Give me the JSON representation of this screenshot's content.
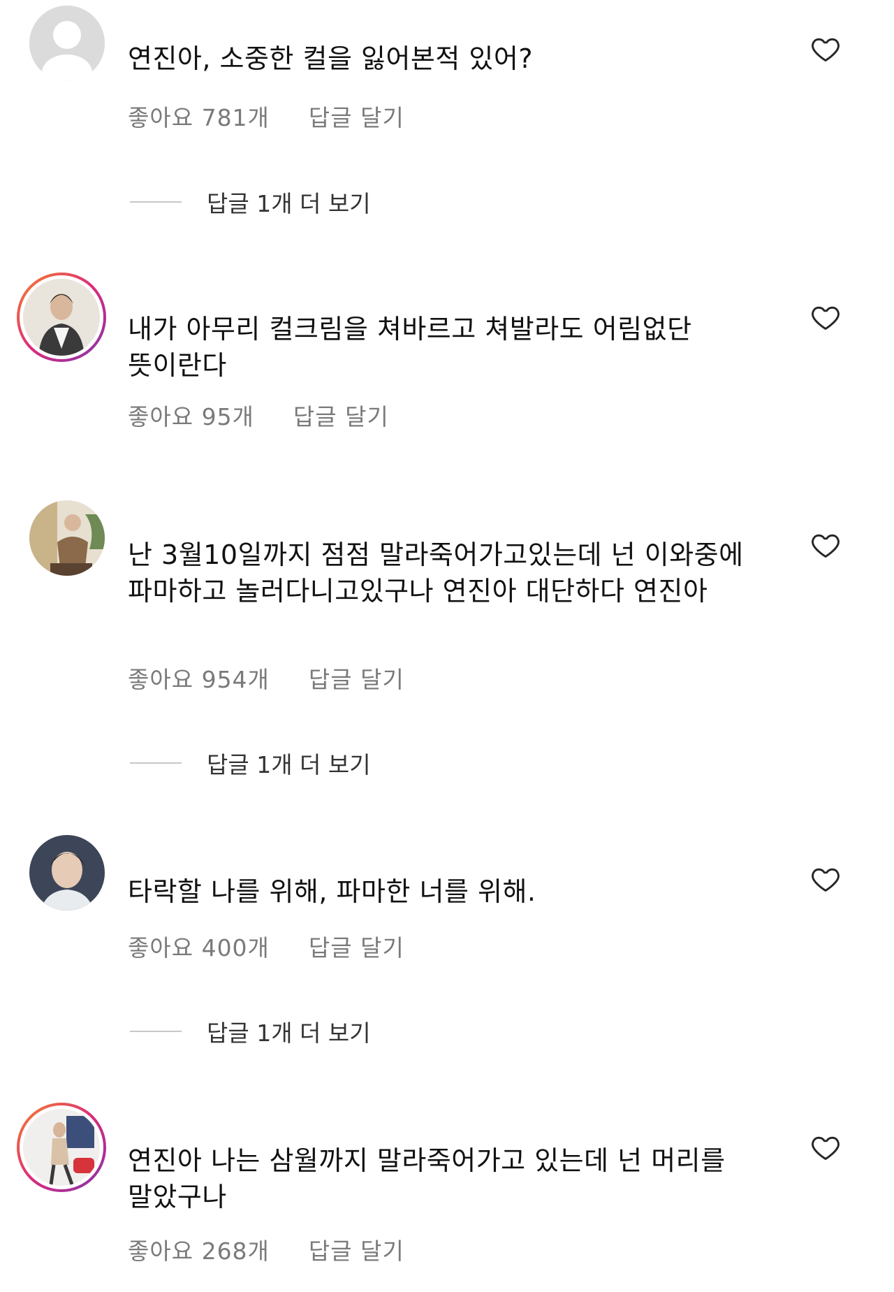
{
  "comments": [
    {
      "text": "연진아, 소중한 컬을 잃어본적 있어?",
      "likes": "좋아요 781개",
      "reply": "답글 달기",
      "more_replies": "답글 1개 더 보기",
      "avatar": "default-profile"
    },
    {
      "text": "내가 아무리 컬크림을 쳐바르고 쳐발라도 어림없단 뜻이란다",
      "likes": "좋아요 95개",
      "reply": "답글 달기",
      "avatar": "photo-with-story-ring"
    },
    {
      "text": "난 3월10일까지 점점 말라죽어가고있는데 넌 이와중에 파마하고 놀러다니고있구나 연진아 대단하다 연진아",
      "likes": "좋아요 954개",
      "reply": "답글 달기",
      "more_replies": "답글 1개 더 보기",
      "avatar": "photo"
    },
    {
      "text": "타락할 나를 위해, 파마한 너를 위해.",
      "likes": "좋아요 400개",
      "reply": "답글 달기",
      "more_replies": "답글 1개 더 보기",
      "avatar": "photo"
    },
    {
      "text": "연진아 나는 삼월까지 말라죽어가고 있는데 넌 머리를 말았구나",
      "likes": "좋아요 268개",
      "reply": "답글 달기",
      "avatar": "photo-with-story-ring"
    }
  ],
  "icons": {
    "like": "heart-outline-icon"
  },
  "colors": {
    "meta_text": "#7a7a7a",
    "story_ring_start": "#f58529",
    "story_ring_end": "#8134af"
  }
}
